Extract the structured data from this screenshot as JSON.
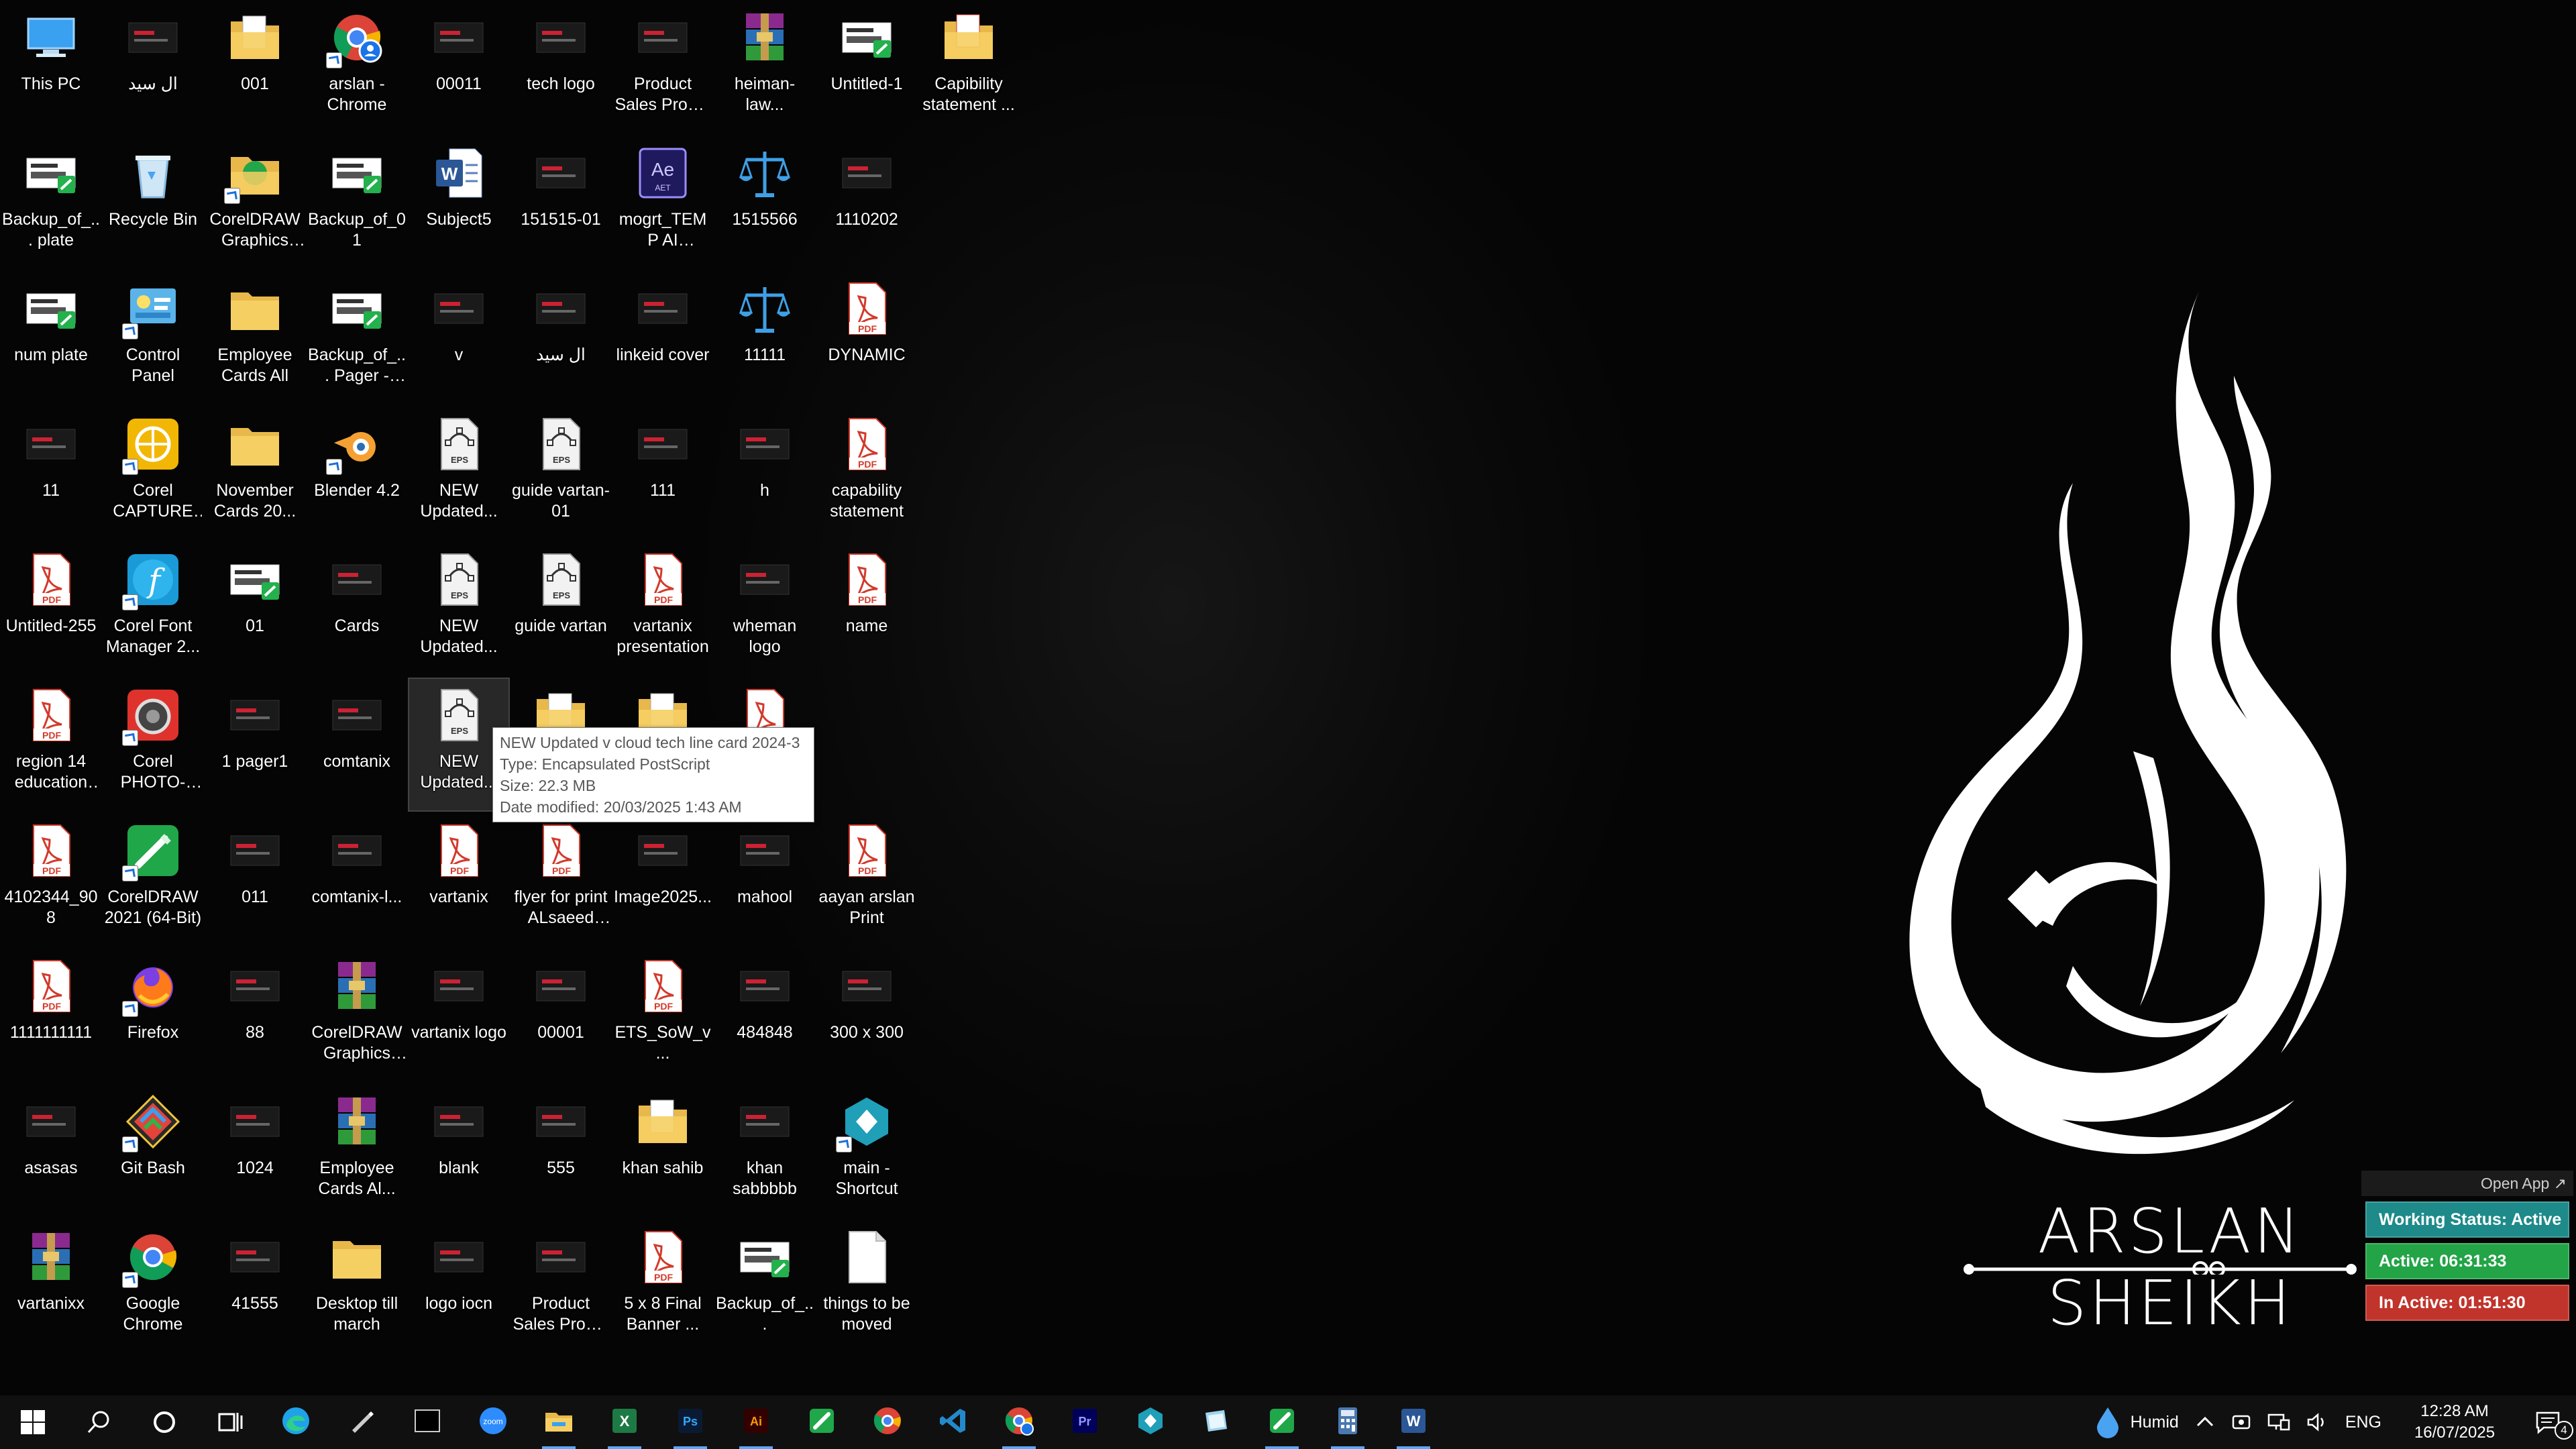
{
  "desktop": {
    "icons": [
      {
        "label": "This PC",
        "icon": "this-pc-icon"
      },
      {
        "label": "ال سید",
        "icon": "image-thumb-icon"
      },
      {
        "label": "001",
        "icon": "folder-doc-icon"
      },
      {
        "label": "arslan - Chrome",
        "icon": "chrome-profile-icon"
      },
      {
        "label": "00011",
        "icon": "image-thumb-icon"
      },
      {
        "label": "tech logo",
        "icon": "image-thumb-icon"
      },
      {
        "label": "Product Sales Promo Pack...",
        "icon": "image-thumb-icon"
      },
      {
        "label": "heiman-law...",
        "icon": "winrar-icon"
      },
      {
        "label": "Untitled-1",
        "icon": "coreldraw-file-icon"
      },
      {
        "label": "Capibility statement ...",
        "icon": "folder-pdf-icon"
      },
      {
        "label": "Backup_of_... plate",
        "icon": "coreldraw-file-icon"
      },
      {
        "label": "Recycle Bin",
        "icon": "recycle-bin-icon"
      },
      {
        "label": "CorelDRAW Graphics Su...",
        "icon": "folder-corel-icon"
      },
      {
        "label": "Backup_of_01",
        "icon": "coreldraw-file-icon"
      },
      {
        "label": "Subject5",
        "icon": "word-doc-icon"
      },
      {
        "label": "151515-01",
        "icon": "image-thumb-icon"
      },
      {
        "label": "mogrt_TEMP AI (convert...",
        "icon": "after-effects-icon"
      },
      {
        "label": "1515566",
        "icon": "scales-icon"
      },
      {
        "label": "1110202",
        "icon": "image-thumb-icon"
      },
      {
        "label": "num plate",
        "icon": "coreldraw-file-icon"
      },
      {
        "label": "Control Panel",
        "icon": "control-panel-icon"
      },
      {
        "label": "Employee Cards All",
        "icon": "folder-icon"
      },
      {
        "label": "Backup_of_... Pager - NY...",
        "icon": "coreldraw-file-icon"
      },
      {
        "label": "v",
        "icon": "image-thumb-icon"
      },
      {
        "label": "ال سید",
        "icon": "image-thumb-icon"
      },
      {
        "label": "linkeid cover",
        "icon": "image-thumb-icon"
      },
      {
        "label": "11111",
        "icon": "scales-icon"
      },
      {
        "label": "DYNAMIC",
        "icon": "pdf-icon"
      },
      {
        "label": "11",
        "icon": "image-thumb-icon"
      },
      {
        "label": "Corel CAPTURE 2...",
        "icon": "corel-capture-icon"
      },
      {
        "label": "November Cards 20...",
        "icon": "folder-icon"
      },
      {
        "label": "Blender 4.2",
        "icon": "blender-icon"
      },
      {
        "label": "NEW Updated...",
        "icon": "eps-icon"
      },
      {
        "label": "guide vartan-01",
        "icon": "eps-icon"
      },
      {
        "label": "111",
        "icon": "image-thumb-icon"
      },
      {
        "label": "h",
        "icon": "image-thumb-icon"
      },
      {
        "label": "capability statement",
        "icon": "pdf-icon"
      },
      {
        "label": "Untitled-255",
        "icon": "pdf-icon"
      },
      {
        "label": "Corel Font Manager 2...",
        "icon": "corel-font-manager-icon"
      },
      {
        "label": "01",
        "icon": "coreldraw-file-icon"
      },
      {
        "label": "Cards",
        "icon": "image-thumb-icon"
      },
      {
        "label": "NEW Updated...",
        "icon": "eps-icon"
      },
      {
        "label": "guide vartan",
        "icon": "eps-icon"
      },
      {
        "label": "vartanix presentation",
        "icon": "pdf-icon"
      },
      {
        "label": "wheman logo",
        "icon": "image-thumb-icon"
      },
      {
        "label": "name",
        "icon": "pdf-icon"
      },
      {
        "label": "region 14 education s...",
        "icon": "pdf-icon"
      },
      {
        "label": "Corel PHOTO-PAI...",
        "icon": "corel-photo-paint-icon"
      },
      {
        "label": "1 pager1",
        "icon": "image-thumb-icon"
      },
      {
        "label": "comtanix",
        "icon": "image-thumb-icon"
      },
      {
        "label": "NEW Updated...",
        "icon": "eps-icon"
      },
      {
        "label": "",
        "icon": "folder-doc-icon"
      },
      {
        "label": "",
        "icon": "folder-doc-icon"
      },
      {
        "label": "aayan arslan",
        "icon": "pdf-icon"
      },
      {
        "label": "4102344_908",
        "icon": "pdf-icon"
      },
      {
        "label": "CorelDRAW 2021 (64-Bit)",
        "icon": "coreldraw-app-icon"
      },
      {
        "label": "011",
        "icon": "image-thumb-icon"
      },
      {
        "label": "comtanix-l...",
        "icon": "image-thumb-icon"
      },
      {
        "label": "vartanix",
        "icon": "pdf-icon"
      },
      {
        "label": "flyer for print ALsaeed po...",
        "icon": "pdf-icon"
      },
      {
        "label": "Image2025...",
        "icon": "image-thumb-icon"
      },
      {
        "label": "mahool",
        "icon": "image-thumb-icon"
      },
      {
        "label": "aayan arslan Print",
        "icon": "pdf-icon"
      },
      {
        "label": "1111111111",
        "icon": "pdf-icon"
      },
      {
        "label": "Firefox",
        "icon": "firefox-icon"
      },
      {
        "label": "88",
        "icon": "image-thumb-icon"
      },
      {
        "label": "CorelDRAW Graphics Su...",
        "icon": "winrar-icon"
      },
      {
        "label": "vartanix logo",
        "icon": "image-thumb-icon"
      },
      {
        "label": "00001",
        "icon": "image-thumb-icon"
      },
      {
        "label": "ETS_SoW_v...",
        "icon": "pdf-icon"
      },
      {
        "label": "484848",
        "icon": "image-thumb-icon"
      },
      {
        "label": "300 x 300",
        "icon": "image-thumb-icon"
      },
      {
        "label": "asasas",
        "icon": "image-thumb-icon"
      },
      {
        "label": "Git Bash",
        "icon": "git-bash-icon"
      },
      {
        "label": "1024",
        "icon": "image-thumb-icon"
      },
      {
        "label": "Employee Cards Al...",
        "icon": "winrar-icon"
      },
      {
        "label": "blank",
        "icon": "image-thumb-icon"
      },
      {
        "label": "555",
        "icon": "image-thumb-icon"
      },
      {
        "label": "khan sahib",
        "icon": "folder-doc-icon"
      },
      {
        "label": "khan sabbbbb",
        "icon": "image-thumb-icon"
      },
      {
        "label": "main - Shortcut",
        "icon": "app-shortcut-icon"
      },
      {
        "label": "vartanixx",
        "icon": "winrar-icon"
      },
      {
        "label": "Google Chrome",
        "icon": "chrome-icon"
      },
      {
        "label": "41555",
        "icon": "image-thumb-icon"
      },
      {
        "label": "Desktop till march",
        "icon": "folder-icon"
      },
      {
        "label": "logo iocn",
        "icon": "image-thumb-icon"
      },
      {
        "label": "Product Sales Promo Pack...",
        "icon": "image-thumb-icon"
      },
      {
        "label": "5 x 8 Final Banner ...",
        "icon": "pdf-icon"
      },
      {
        "label": "Backup_of_...",
        "icon": "coreldraw-file-icon"
      },
      {
        "label": "things to be moved",
        "icon": "blank-file-icon"
      }
    ]
  },
  "tooltip": {
    "name": "NEW Updated v cloud tech line card 2024-3",
    "type": "Type: Encapsulated PostScript",
    "size": "Size: 22.3 MB",
    "modified": "Date modified: 20/03/2025 1:43 AM"
  },
  "wallpaper": {
    "brand_name": "ARSLAN SHEIKH"
  },
  "status_widget": {
    "open_app": "Open App ↗",
    "working": "Working Status: Active",
    "active": "Active: 06:31:33",
    "inactive": "In Active: 01:51:30",
    "colors": {
      "working": "#1e8a8a",
      "active": "#22a447",
      "inactive": "#c0342b"
    }
  },
  "taskbar": {
    "start": "start-icon",
    "apps": [
      {
        "name": "edge",
        "icon": "edge-icon",
        "running": false
      },
      {
        "name": "pen-tool",
        "icon": "pen-icon",
        "running": false
      },
      {
        "name": "terminal",
        "icon": "terminal-icon",
        "running": false
      },
      {
        "name": "zoom",
        "icon": "zoom-icon",
        "running": false
      },
      {
        "name": "file-explorer",
        "icon": "file-explorer-icon",
        "running": true
      },
      {
        "name": "excel",
        "icon": "excel-icon",
        "running": true
      },
      {
        "name": "photoshop",
        "icon": "photoshop-icon",
        "running": true
      },
      {
        "name": "illustrator",
        "icon": "illustrator-icon",
        "running": true
      },
      {
        "name": "coreldraw",
        "icon": "coreldraw-icon",
        "running": false
      },
      {
        "name": "chrome",
        "icon": "chrome-icon",
        "running": false
      },
      {
        "name": "vscode",
        "icon": "vscode-icon",
        "running": false
      },
      {
        "name": "chrome-profile",
        "icon": "chrome-profile-icon",
        "running": true
      },
      {
        "name": "premiere",
        "icon": "premiere-icon",
        "running": false
      },
      {
        "name": "app",
        "icon": "app-shortcut-icon",
        "running": false
      },
      {
        "name": "paper",
        "icon": "paper-icon",
        "running": false
      },
      {
        "name": "coreldraw-2",
        "icon": "coreldraw-icon",
        "running": true
      },
      {
        "name": "calculator",
        "icon": "calculator-icon",
        "running": true
      },
      {
        "name": "word",
        "icon": "word-icon",
        "running": true
      }
    ],
    "weather": "Humid",
    "language": "ENG",
    "time": "12:28 AM",
    "date": "16/07/2025",
    "notification_count": "4"
  }
}
